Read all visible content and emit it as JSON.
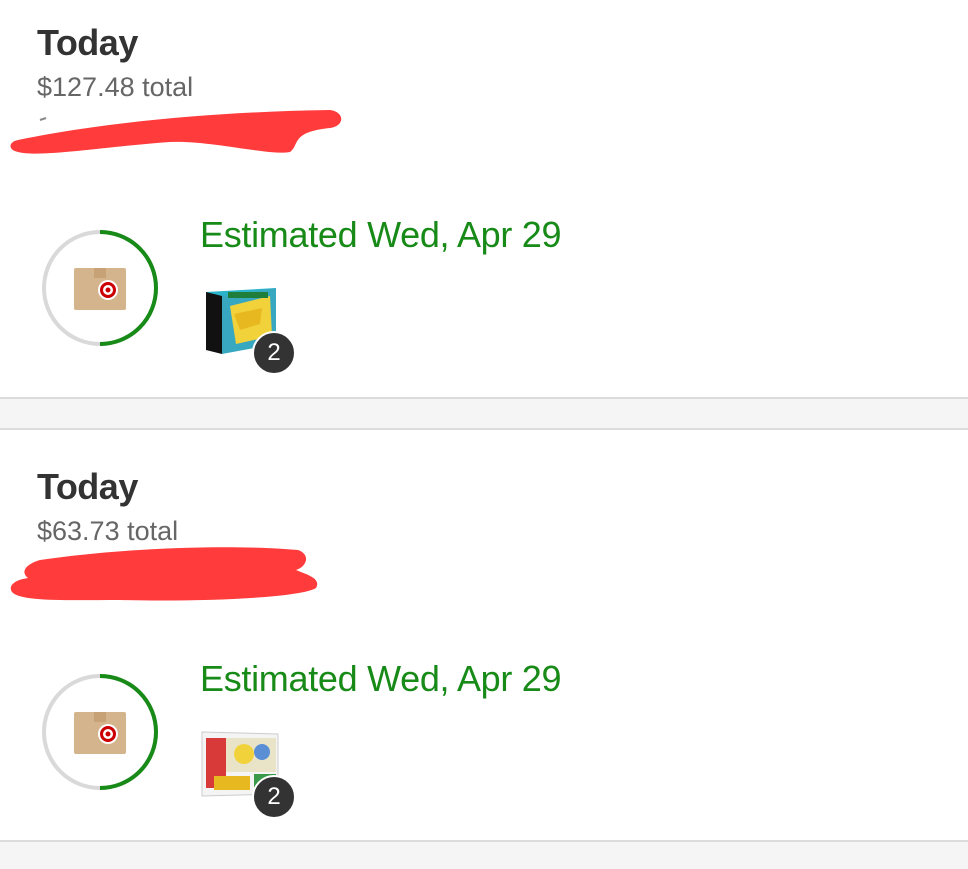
{
  "orders": [
    {
      "date_label": "Today",
      "total_text": "$127.48 total",
      "estimate_text": "Estimated Wed, Apr 29",
      "quantity": "2",
      "progress_fraction": 0.5,
      "icon": "target-package-icon",
      "thumbnail": "pokemon-elite-trainer-box-thumbnail"
    },
    {
      "date_label": "Today",
      "total_text": "$63.73 total",
      "estimate_text": "Estimated Wed, Apr 29",
      "quantity": "2",
      "progress_fraction": 0.5,
      "icon": "target-package-icon",
      "thumbnail": "pokemon-collection-box-thumbnail"
    }
  ],
  "colors": {
    "accent_green": "#178a17",
    "ring_gray": "#d9d9d9",
    "redaction_red": "#ff3b3b",
    "badge_bg": "#333333",
    "target_red": "#cc0000",
    "box_tan": "#d4b48c"
  }
}
